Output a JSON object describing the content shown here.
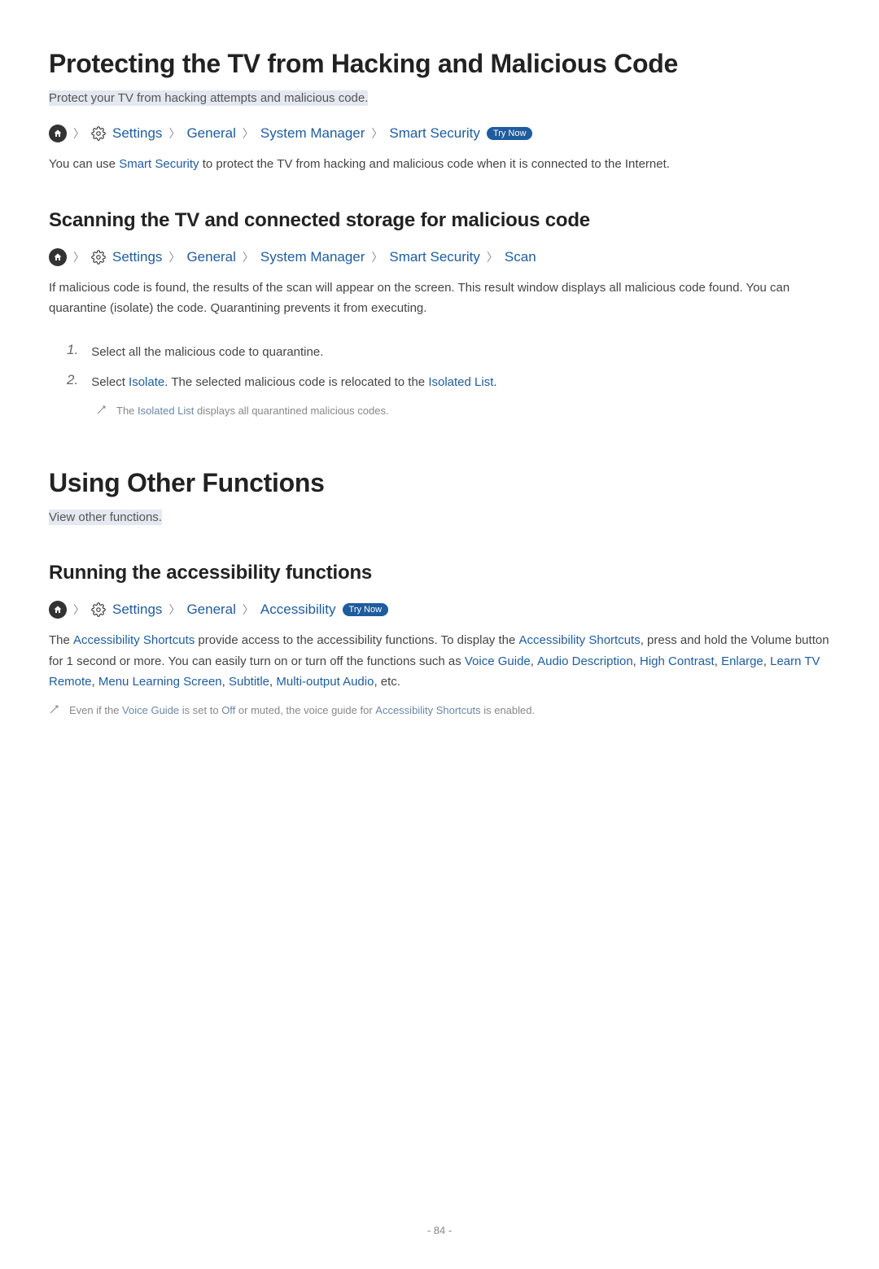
{
  "title1": "Protecting the TV from Hacking and Malicious Code",
  "subtitle1": "Protect your TV from hacking attempts and malicious code.",
  "breadcrumb1": {
    "settings": "Settings",
    "general": "General",
    "system_manager": "System Manager",
    "smart_security": "Smart Security",
    "try_now": "Try Now"
  },
  "body1_pre": "You can use ",
  "body1_link": "Smart Security",
  "body1_post": " to protect the TV from hacking and malicious code when it is connected to the Internet.",
  "h2_1": "Scanning the TV and connected storage for malicious code",
  "breadcrumb2": {
    "settings": "Settings",
    "general": "General",
    "system_manager": "System Manager",
    "smart_security": "Smart Security",
    "scan": "Scan"
  },
  "body2": "If malicious code is found, the results of the scan will appear on the screen. This result window displays all malicious code found. You can quarantine (isolate) the code. Quarantining prevents it from executing.",
  "step1": "Select all the malicious code to quarantine.",
  "step2_pre": "Select ",
  "step2_link1": "Isolate",
  "step2_mid": ". The selected malicious code is relocated to the ",
  "step2_link2": "Isolated List",
  "step2_post": ".",
  "note1_pre": "The ",
  "note1_link": "Isolated List",
  "note1_post": " displays all quarantined malicious codes.",
  "title2": "Using Other Functions",
  "subtitle2": "View other functions.",
  "h2_2": "Running the accessibility functions",
  "breadcrumb3": {
    "settings": "Settings",
    "general": "General",
    "accessibility": "Accessibility",
    "try_now": "Try Now"
  },
  "body3_pre": "The ",
  "body3_link1": "Accessibility Shortcuts",
  "body3_mid1": " provide access to the accessibility functions. To display the ",
  "body3_link2": "Accessibility Shortcuts",
  "body3_mid2": ", press and hold the Volume button for 1 second or more. You can easily turn on or turn off the functions such as ",
  "body3_link3": "Voice Guide",
  "body3_sep1": ", ",
  "body3_link4": "Audio Description",
  "body3_sep2": ", ",
  "body3_link5": "High Contrast",
  "body3_sep3": ", ",
  "body3_link6": "Enlarge",
  "body3_sep4": ", ",
  "body3_link7": "Learn TV Remote",
  "body3_sep5": ", ",
  "body3_link8": "Menu Learning Screen",
  "body3_sep6": ", ",
  "body3_link9": "Subtitle",
  "body3_sep7": ", ",
  "body3_link10": "Multi-output Audio",
  "body3_post": ", etc.",
  "note2_pre": "Even if the ",
  "note2_link1": "Voice Guide",
  "note2_mid1": " is set to ",
  "note2_link2": "Off",
  "note2_mid2": " or muted, the voice guide for ",
  "note2_link3": "Accessibility Shortcuts",
  "note2_post": " is enabled.",
  "page_number": "- 84 -"
}
